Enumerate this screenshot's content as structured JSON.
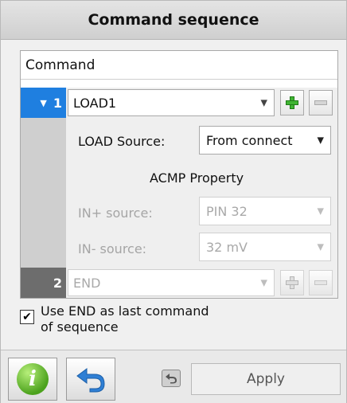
{
  "title": "Command sequence",
  "table": {
    "column_header": "Command"
  },
  "commands": [
    {
      "number": "1",
      "name": "LOAD1",
      "expanded": true
    },
    {
      "number": "2",
      "name": "END",
      "expanded": false
    }
  ],
  "load_props": {
    "source_label": "LOAD Source:",
    "source_value": "From connect",
    "section_title": "ACMP Property",
    "in_plus_label": "IN+ source:",
    "in_plus_value": "PIN 32",
    "in_minus_label": "IN- source:",
    "in_minus_value": "32 mV"
  },
  "end_option": {
    "line1": "Use END as last command",
    "line2": "of sequence",
    "checked": true,
    "check_mark": "✔"
  },
  "buttons": {
    "apply_label": "Apply",
    "info_glyph": "i"
  },
  "colors": {
    "accent": "#1f7fe0",
    "plus_green": "#3fb432",
    "info_green": "#4ca21d",
    "undo_blue": "#2f7fd4"
  }
}
